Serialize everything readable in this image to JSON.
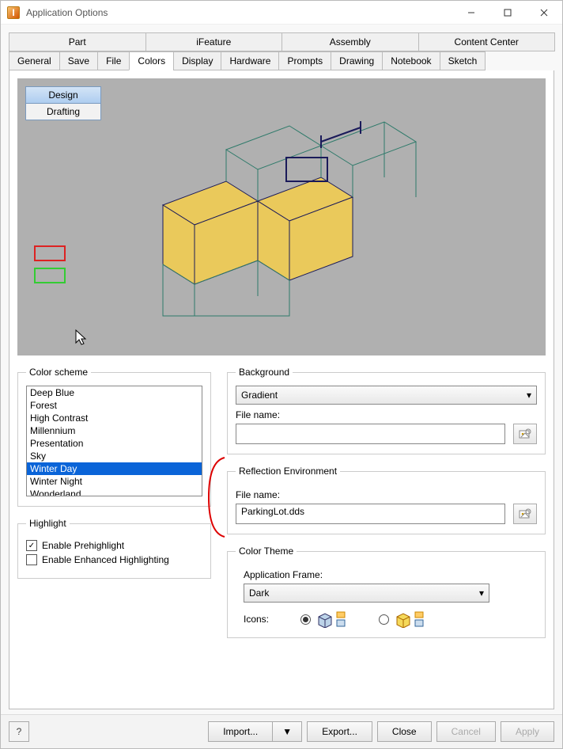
{
  "window": {
    "title": "Application Options",
    "icon_letter": "I"
  },
  "tabs_top": [
    {
      "label": "Part"
    },
    {
      "label": "iFeature"
    },
    {
      "label": "Assembly"
    },
    {
      "label": "Content Center"
    }
  ],
  "tabs_bottom": [
    {
      "label": "General"
    },
    {
      "label": "Save"
    },
    {
      "label": "File"
    },
    {
      "label": "Colors",
      "active": true
    },
    {
      "label": "Display"
    },
    {
      "label": "Hardware"
    },
    {
      "label": "Prompts"
    },
    {
      "label": "Drawing"
    },
    {
      "label": "Notebook"
    },
    {
      "label": "Sketch"
    }
  ],
  "preview": {
    "mode_buttons": [
      {
        "label": "Design",
        "active": true
      },
      {
        "label": "Drafting",
        "active": false
      }
    ]
  },
  "color_scheme": {
    "legend": "Color scheme",
    "items": [
      "Deep Blue",
      "Forest",
      "High Contrast",
      "Millennium",
      "Presentation",
      "Sky",
      "Winter Day",
      "Winter Night",
      "Wonderland"
    ],
    "selected": "Winter Day"
  },
  "highlight": {
    "legend": "Highlight",
    "prehighlight": {
      "label": "Enable Prehighlight",
      "checked": true
    },
    "enhanced": {
      "label": "Enable Enhanced Highlighting",
      "checked": false
    }
  },
  "background": {
    "legend": "Background",
    "dropdown_value": "Gradient",
    "file_label": "File name:",
    "file_value": ""
  },
  "reflection": {
    "legend": "Reflection Environment",
    "file_label": "File name:",
    "file_value": "ParkingLot.dds"
  },
  "color_theme": {
    "legend": "Color Theme",
    "frame_label": "Application Frame:",
    "frame_value": "Dark",
    "icons_label": "Icons:",
    "selected_icon_set": 0
  },
  "footer": {
    "help": "?",
    "import": "Import...",
    "export": "Export...",
    "close": "Close",
    "cancel": "Cancel",
    "apply": "Apply"
  }
}
